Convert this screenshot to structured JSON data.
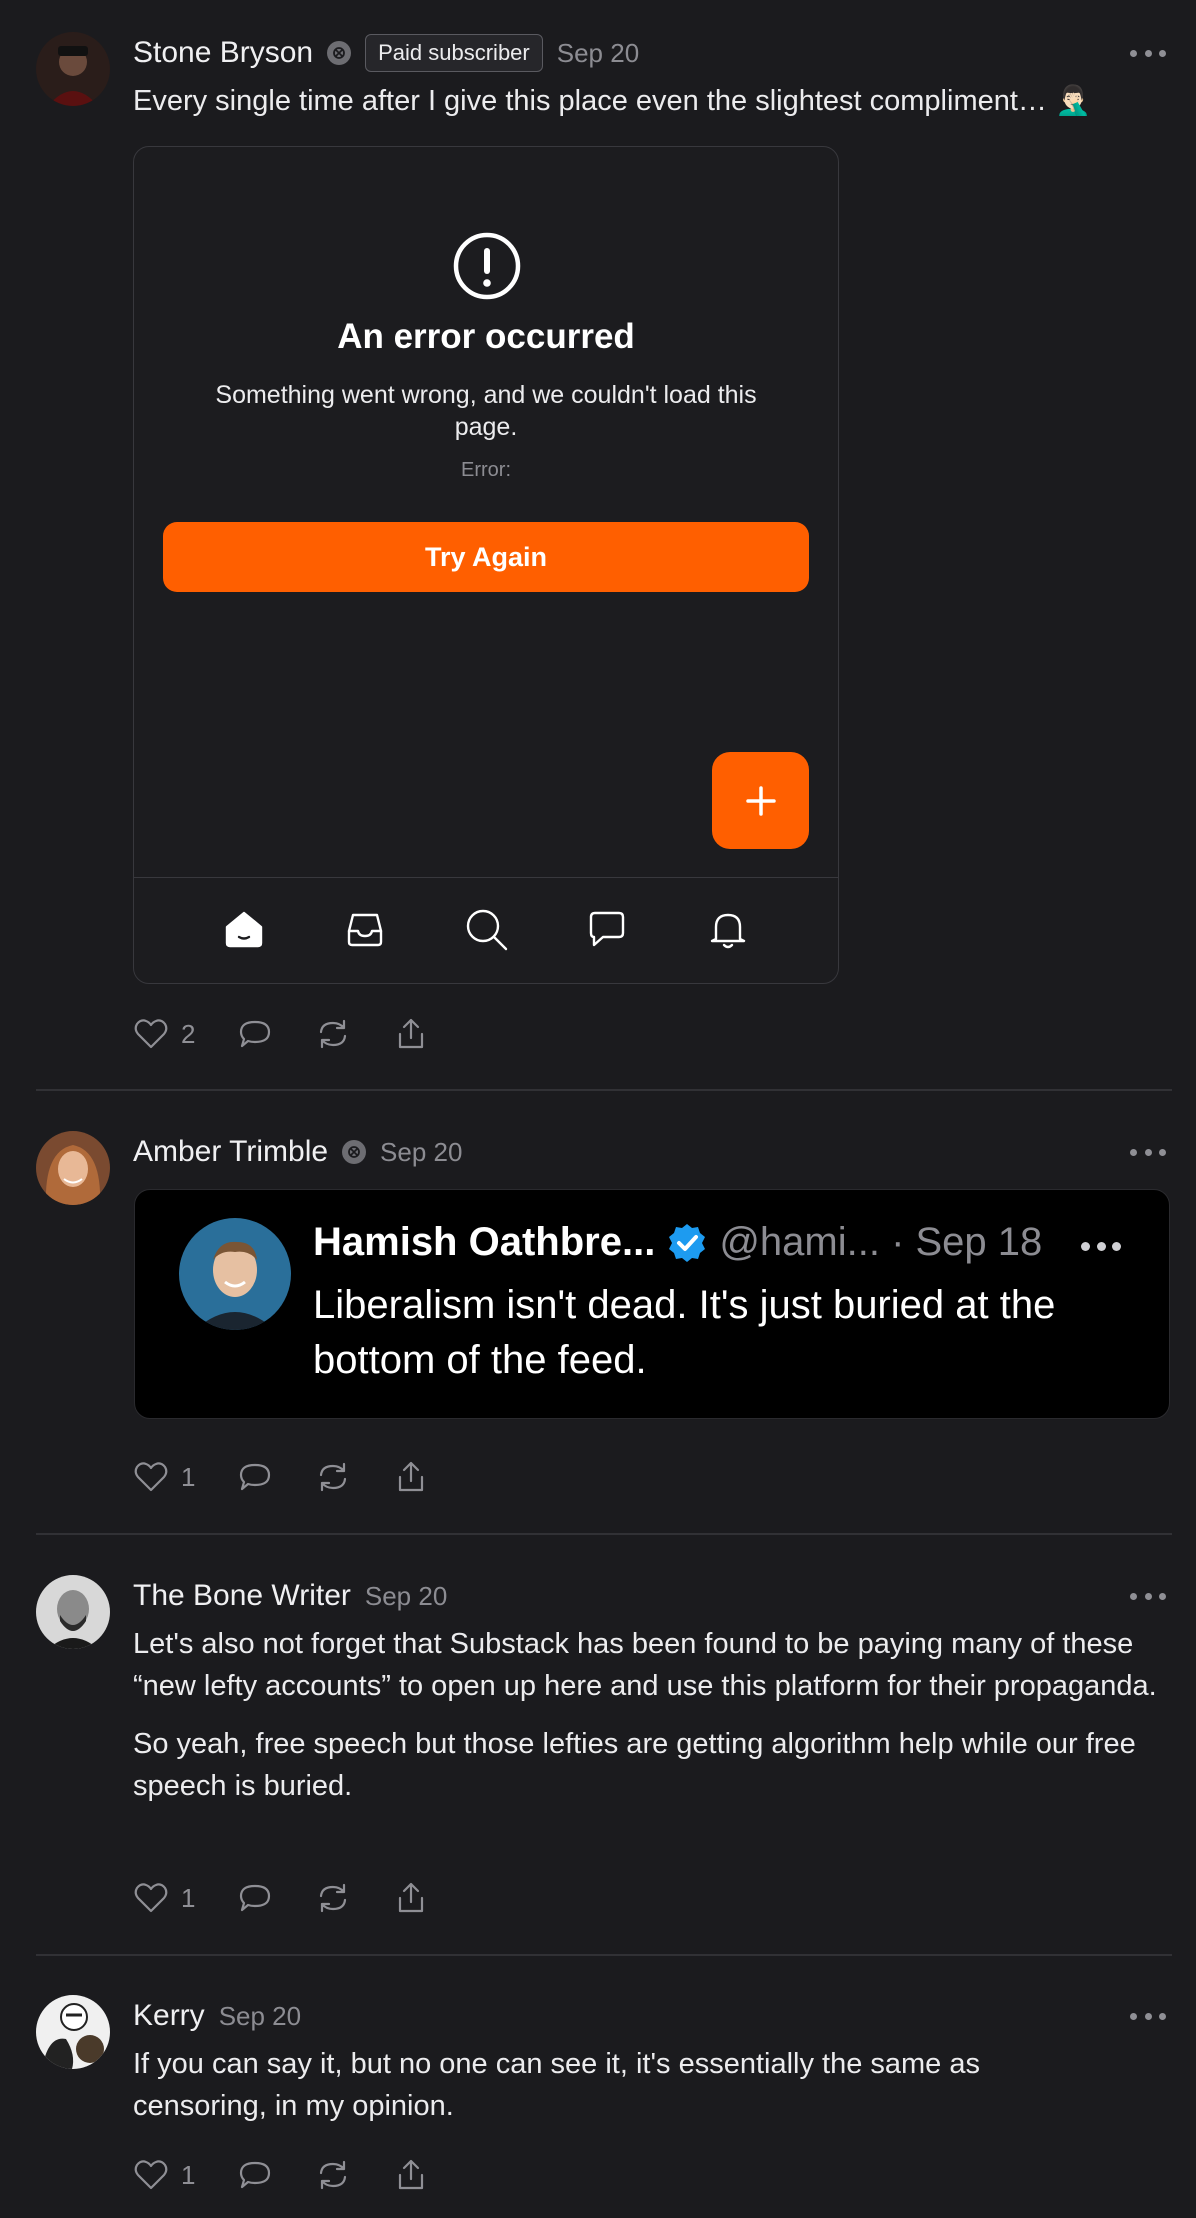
{
  "posts": [
    {
      "author": "Stone Bryson",
      "paid_badge": "Paid subscriber",
      "date": "Sep 20",
      "text": "Every single time after I give this place even the slightest compliment… 🤦🏻‍♂️",
      "embed": {
        "error_title": "An error occurred",
        "error_message": "Something went wrong, and we couldn't load this page.",
        "error_code": "Error:",
        "try_again_label": "Try Again",
        "fab_label": "+",
        "tabs": [
          "home-icon",
          "inbox-icon",
          "search-icon",
          "chat-icon",
          "bell-icon"
        ]
      },
      "likes": "2"
    },
    {
      "author": "Amber Trimble",
      "date": "Sep 20",
      "quote": {
        "name": "Hamish Oathbre...",
        "handle": "@hami... · Sep 18",
        "text": "Liberalism isn't dead. It's just buried at the bottom of the feed."
      },
      "likes": "1"
    },
    {
      "author": "The Bone Writer",
      "date": "Sep 20",
      "paragraphs": [
        "Let's also not forget that Substack has been found to be paying many of these “new lefty accounts” to open up here and use this platform for their propaganda.",
        "So yeah, free speech but those lefties are getting algorithm help while our free speech is buried."
      ],
      "likes": "1"
    },
    {
      "author": "Kerry",
      "date": "Sep 20",
      "text": "If you can say it, but no one can see it, it's essentially the same as censoring, in my opinion.",
      "likes": "1"
    }
  ],
  "colors": {
    "background": "#1b1b1e",
    "accent": "#ff5f00",
    "muted": "#8c8c92",
    "verified": "#1d9bf0"
  }
}
